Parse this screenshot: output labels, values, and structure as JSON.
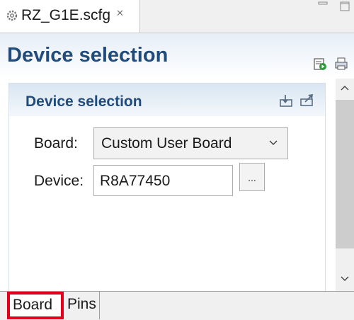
{
  "editor_tab": {
    "label": "RZ_G1E.scfg",
    "close_symbol": "✕",
    "icon": "gear-icon"
  },
  "form": {
    "title": "Device selection"
  },
  "section": {
    "title": "Device selection",
    "board_label": "Board:",
    "board_value": "Custom User Board",
    "device_label": "Device:",
    "device_value": "R8A77450",
    "browse_label": "..."
  },
  "bottom_tabs": [
    {
      "label": "Board"
    },
    {
      "label": "Pins"
    }
  ],
  "colors": {
    "title": "#214b7a",
    "highlight_border": "#e3001b"
  }
}
